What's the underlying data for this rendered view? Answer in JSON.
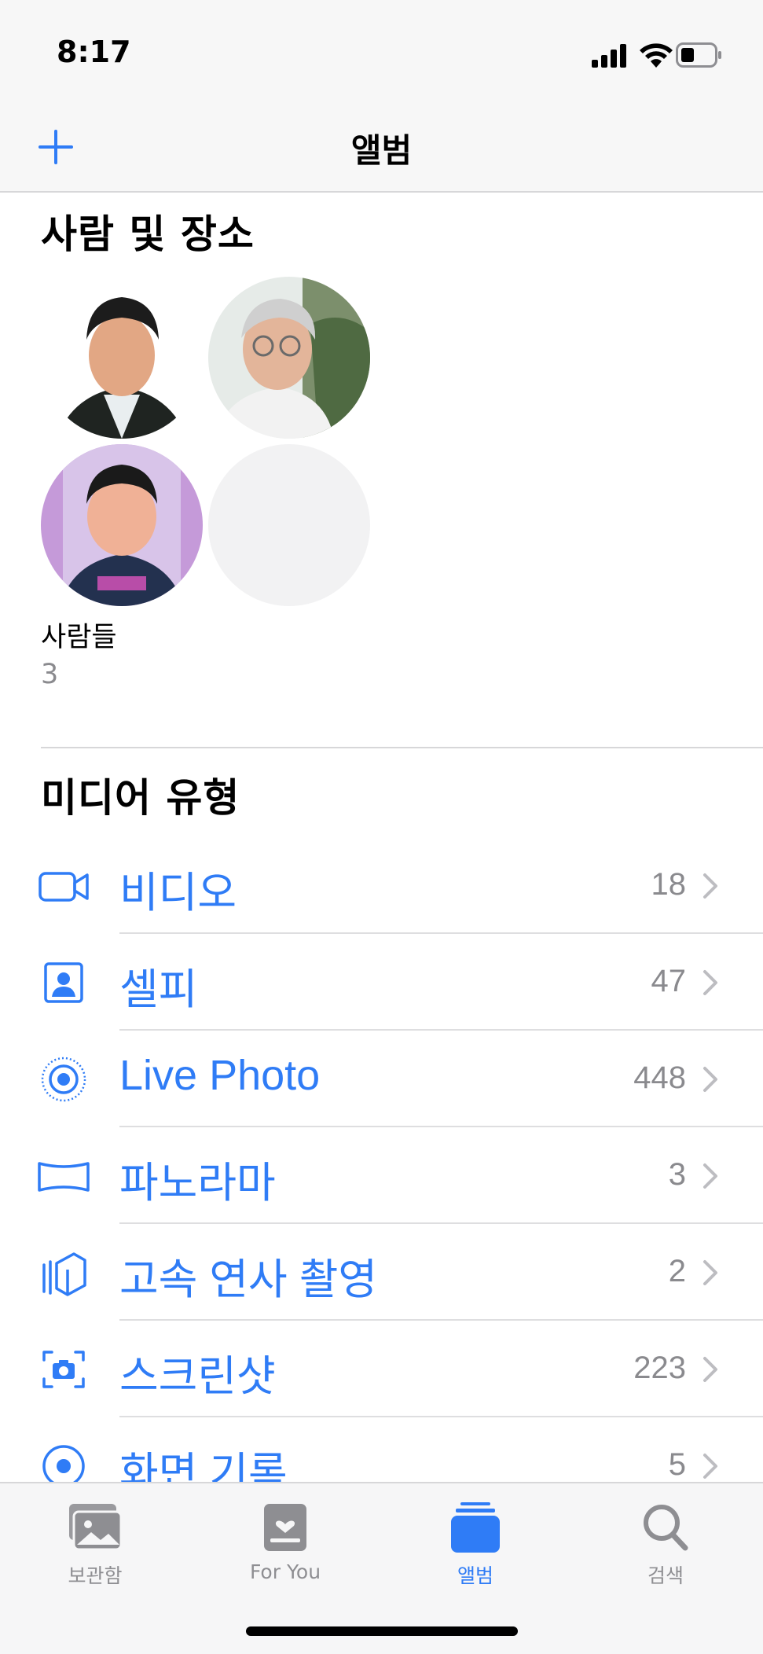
{
  "status_bar": {
    "time": "8:17"
  },
  "nav": {
    "title": "앨범",
    "add_icon": "plus-icon"
  },
  "people_places": {
    "title": "사람 및 장소",
    "album_label": "사람들",
    "album_count": "3"
  },
  "media_types": {
    "title": "미디어 유형",
    "items": [
      {
        "label": "비디오",
        "count": "18",
        "icon": "video-icon"
      },
      {
        "label": "셀피",
        "count": "47",
        "icon": "selfie-icon"
      },
      {
        "label": "Live Photo",
        "count": "448",
        "icon": "live-photo-icon"
      },
      {
        "label": "파노라마",
        "count": "3",
        "icon": "panorama-icon"
      },
      {
        "label": "고속 연사 촬영",
        "count": "2",
        "icon": "burst-icon"
      },
      {
        "label": "스크린샷",
        "count": "223",
        "icon": "screenshot-icon"
      },
      {
        "label": "화면 기록",
        "count": "5",
        "icon": "screen-recording-icon"
      }
    ]
  },
  "tab_bar": {
    "tabs": [
      {
        "label": "보관함",
        "icon": "library-icon",
        "active": false
      },
      {
        "label": "For You",
        "icon": "for-you-icon",
        "active": false
      },
      {
        "label": "앨범",
        "icon": "albums-icon",
        "active": true
      },
      {
        "label": "검색",
        "icon": "search-icon",
        "active": false
      }
    ]
  },
  "colors": {
    "accent": "#2f7cf6",
    "secondary_text": "#8a8a8e",
    "separator": "#d7d7d9"
  }
}
